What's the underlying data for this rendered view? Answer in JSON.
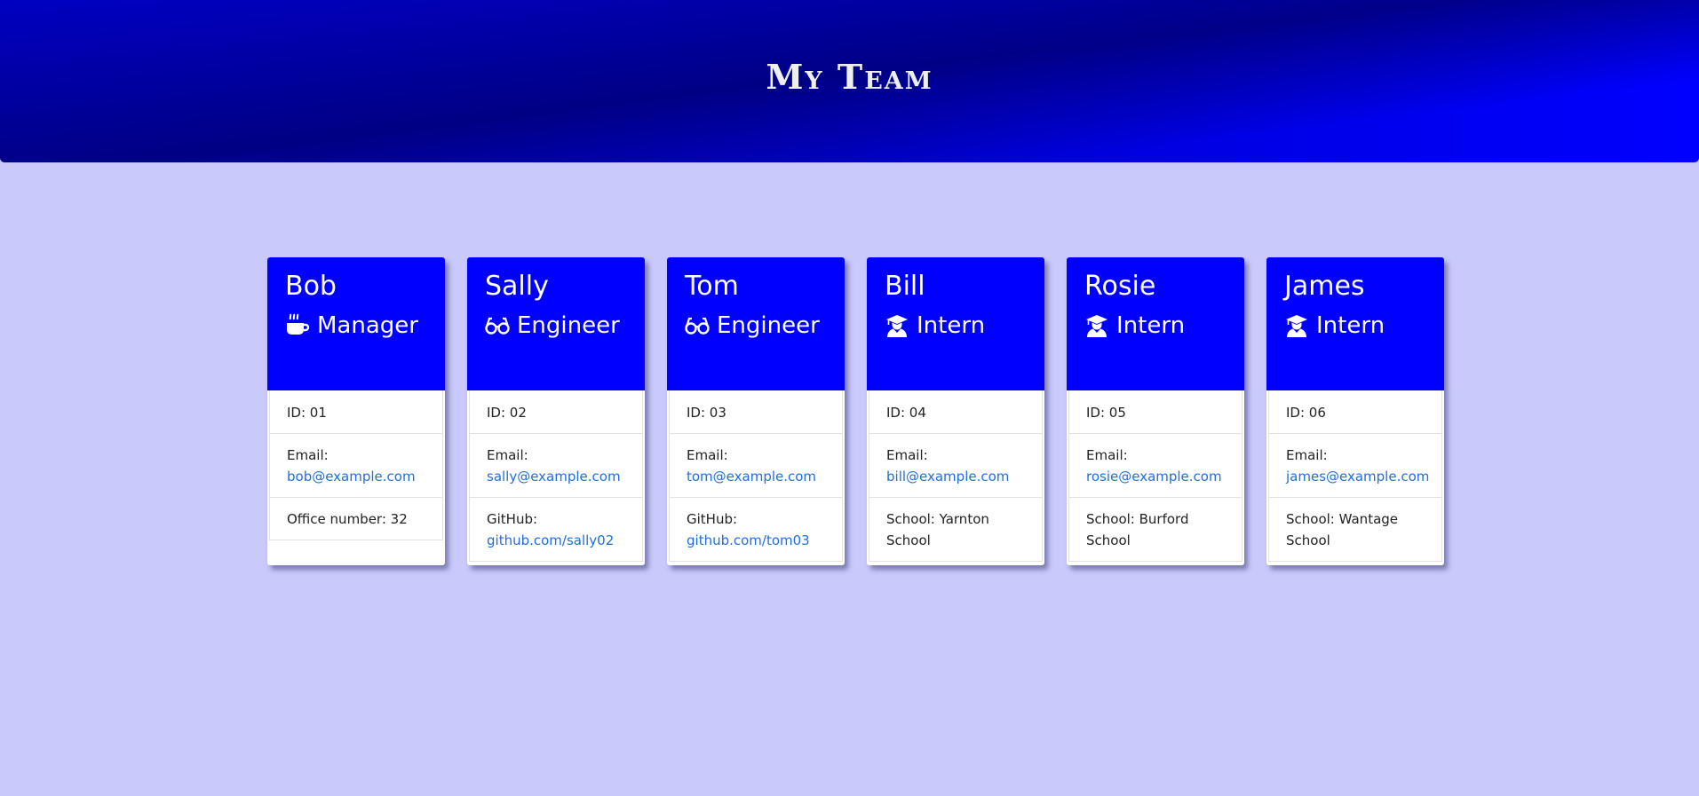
{
  "header": {
    "title": "My Team"
  },
  "colors": {
    "header": "#0000ff",
    "background": "#c9c9fb",
    "link": "#1f6fe0"
  },
  "team": [
    {
      "name": "Bob",
      "role": "Manager",
      "icon": "coffee-icon",
      "id_label": "ID: 01",
      "email_label": "Email:",
      "email": "bob@example.com",
      "extra_label": "Office number: 32",
      "extra_link": ""
    },
    {
      "name": "Sally",
      "role": "Engineer",
      "icon": "glasses-icon",
      "id_label": "ID: 02",
      "email_label": "Email:",
      "email": "sally@example.com",
      "extra_label": "GitHub:",
      "extra_link": "github.com/sally02"
    },
    {
      "name": "Tom",
      "role": "Engineer",
      "icon": "glasses-icon",
      "id_label": "ID: 03",
      "email_label": "Email:",
      "email": "tom@example.com",
      "extra_label": "GitHub:",
      "extra_link": "github.com/tom03"
    },
    {
      "name": "Bill",
      "role": "Intern",
      "icon": "graduate-icon",
      "id_label": "ID: 04",
      "email_label": "Email:",
      "email": "bill@example.com",
      "extra_label": "School: Yarnton School",
      "extra_link": ""
    },
    {
      "name": "Rosie",
      "role": "Intern",
      "icon": "graduate-icon",
      "id_label": "ID: 05",
      "email_label": "Email:",
      "email": "rosie@example.com",
      "extra_label": "School: Burford School",
      "extra_link": ""
    },
    {
      "name": "James",
      "role": "Intern",
      "icon": "graduate-icon",
      "id_label": "ID: 06",
      "email_label": "Email:",
      "email": "james@example.com",
      "extra_label": "School: Wantage School",
      "extra_link": ""
    }
  ]
}
